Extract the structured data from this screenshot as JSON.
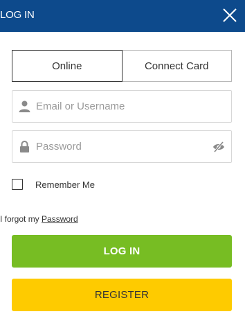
{
  "header": {
    "title": "LOG IN"
  },
  "tabs": [
    {
      "label": "Online",
      "active": true
    },
    {
      "label": "Connect Card",
      "active": false
    }
  ],
  "form": {
    "username_placeholder": "Email or Username",
    "password_placeholder": "Password",
    "remember_label": "Remember Me",
    "remember_checked": false,
    "forgot_prefix": "I forgot my",
    "forgot_link": "Password"
  },
  "buttons": {
    "login_label": "LOG IN",
    "register_label": "REGISTER"
  },
  "colors": {
    "header_bg": "#0d4a8c",
    "login_bg": "#77bd23",
    "register_bg": "#fecb00"
  },
  "icons": {
    "close": "close-icon",
    "user": "user-icon",
    "lock": "lock-icon",
    "eye": "eye-slash-icon"
  }
}
